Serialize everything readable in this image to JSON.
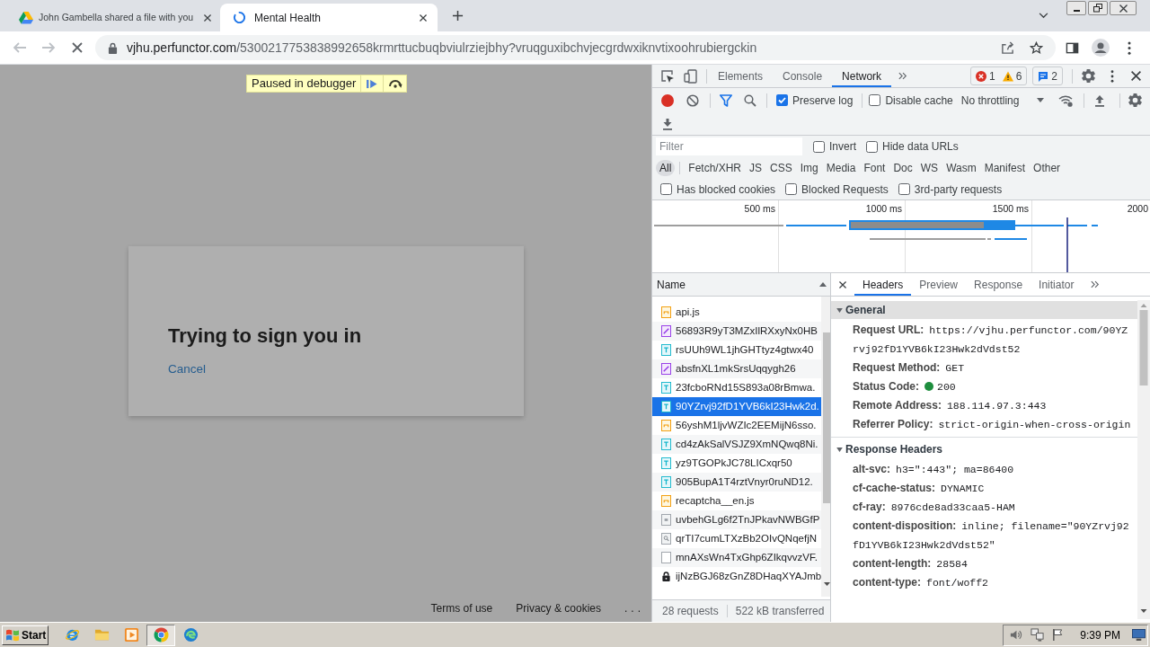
{
  "browser": {
    "tabs": [
      {
        "title": "John Gambella shared a file with you",
        "selected": false,
        "loading": false
      },
      {
        "title": "Mental Health",
        "selected": true,
        "loading": true
      }
    ],
    "address": {
      "domain": "vjhu.perfunctor.com",
      "path": "/5300217753838992658krmrttucbuqbviulrziejbhy?vruqguxibchvjecgrdwxiknvtixoohrubiergckin"
    }
  },
  "page": {
    "debugger_banner": "Paused in debugger",
    "dialog": {
      "heading": "Trying to sign you in",
      "cancel": "Cancel"
    },
    "footer_links": [
      "Terms of use",
      "Privacy & cookies",
      "..."
    ]
  },
  "devtools": {
    "tabs": [
      {
        "label": "Elements",
        "selected": false
      },
      {
        "label": "Console",
        "selected": false
      },
      {
        "label": "Network",
        "selected": true
      }
    ],
    "counters": [
      {
        "kind": "error",
        "count": "1"
      },
      {
        "kind": "warning",
        "count": "6"
      },
      {
        "kind": "message",
        "count": "2"
      }
    ],
    "toolbar": {
      "recording": true,
      "options": [
        {
          "label": "Preserve log",
          "checked": true
        },
        {
          "label": "Disable cache",
          "checked": false
        }
      ],
      "throttling": "No throttling"
    },
    "filter": {
      "placeholder": "Filter",
      "options": [
        {
          "label": "Invert",
          "checked": false
        },
        {
          "label": "Hide data URLs",
          "checked": false
        }
      ]
    },
    "types": [
      {
        "label": "All",
        "selected": true
      },
      {
        "label": "Fetch/XHR",
        "selected": false
      },
      {
        "label": "JS",
        "selected": false
      },
      {
        "label": "CSS",
        "selected": false
      },
      {
        "label": "Img",
        "selected": false
      },
      {
        "label": "Media",
        "selected": false
      },
      {
        "label": "Font",
        "selected": false
      },
      {
        "label": "Doc",
        "selected": false
      },
      {
        "label": "WS",
        "selected": false
      },
      {
        "label": "Wasm",
        "selected": false
      },
      {
        "label": "Manifest",
        "selected": false
      },
      {
        "label": "Other",
        "selected": false
      }
    ],
    "request_options": [
      {
        "label": "Has blocked cookies",
        "checked": false
      },
      {
        "label": "Blocked Requests",
        "checked": false
      },
      {
        "label": "3rd-party requests",
        "checked": false
      }
    ],
    "overview": {
      "ticks": [
        "500 ms",
        "1000 ms",
        "1500 ms",
        "2000"
      ]
    },
    "requests": {
      "column": "Name",
      "rows": [
        {
          "name": "api.js",
          "kind": "script",
          "selected": false
        },
        {
          "name": "56893R9yT3MZxIlRXxyNx0HB",
          "kind": "image",
          "selected": false
        },
        {
          "name": "rsUUh9WL1jhGHTtyz4gtwx40",
          "kind": "font",
          "selected": false
        },
        {
          "name": "absfnXL1mkSrsUqqygh26",
          "kind": "image",
          "selected": false
        },
        {
          "name": "23fcboRNd15S893a08rBmwa.",
          "kind": "font",
          "selected": false
        },
        {
          "name": "90YZrvj92fD1YVB6kI23Hwk2d.",
          "kind": "font",
          "selected": true
        },
        {
          "name": "56yshM1ljvWZIc2EEMijN6sso.",
          "kind": "script",
          "selected": false
        },
        {
          "name": "cd4zAkSalVSJZ9XmNQwq8Ni.",
          "kind": "font",
          "selected": false
        },
        {
          "name": "yz9TGOPkJC78LICxqr50",
          "kind": "font",
          "selected": false
        },
        {
          "name": "905BupA1T4rztVnyr0ruND12.",
          "kind": "font",
          "selected": false
        },
        {
          "name": "recaptcha__en.js",
          "kind": "script",
          "selected": false
        },
        {
          "name": "uvbehGLg6f2TnJPkavNWBGfP",
          "kind": "other",
          "selected": false
        },
        {
          "name": "qrTI7cumLTXzBb2OIvQNqefjN",
          "kind": "preview",
          "selected": false
        },
        {
          "name": "mnAXsWn4TxGhp6ZIkqvvzVF.",
          "kind": "document",
          "selected": false
        },
        {
          "name": "ijNzBGJ68zGnZ8DHaqXYAJmb",
          "kind": "locked",
          "selected": false
        }
      ],
      "summary": [
        "28 requests",
        "522 kB transferred"
      ]
    },
    "details": {
      "tabs": [
        {
          "label": "Headers",
          "selected": true
        },
        {
          "label": "Preview",
          "selected": false
        },
        {
          "label": "Response",
          "selected": false
        },
        {
          "label": "Initiator",
          "selected": false
        }
      ],
      "sections": [
        {
          "title": "General",
          "expanded": true,
          "selected": true,
          "rows": [
            {
              "kind": "field",
              "label": "Request URL:",
              "value": "https://vjhu.perfunctor.com/90YZrvj92fD1YVB6kI23Hwk2dVdst52"
            },
            {
              "kind": "field",
              "label": "Request Method:",
              "value": "GET"
            },
            {
              "kind": "status",
              "label": "Status Code:",
              "value": "200"
            },
            {
              "kind": "field",
              "label": "Remote Address:",
              "value": "188.114.97.3:443"
            },
            {
              "kind": "field",
              "label": "Referrer Policy:",
              "value": "strict-origin-when-cross-origin"
            }
          ]
        },
        {
          "title": "Response Headers",
          "expanded": true,
          "selected": false,
          "rows": [
            {
              "kind": "field",
              "label": "alt-svc:",
              "value": "h3=\":443\"; ma=86400"
            },
            {
              "kind": "field",
              "label": "cf-cache-status:",
              "value": "DYNAMIC"
            },
            {
              "kind": "field",
              "label": "cf-ray:",
              "value": "8976cde8ad33caa5-HAM"
            },
            {
              "kind": "field",
              "label": "content-disposition:",
              "value": "inline; filename=\"90YZrvj92fD1YVB6kI23Hwk2dVdst52\""
            },
            {
              "kind": "field",
              "label": "content-length:",
              "value": "28584"
            },
            {
              "kind": "field",
              "label": "content-type:",
              "value": "font/woff2"
            }
          ]
        }
      ]
    }
  },
  "taskbar": {
    "start": "Start",
    "apps": [
      {
        "kind": "e_logo",
        "active": false
      },
      {
        "kind": "folder",
        "active": false
      },
      {
        "kind": "player",
        "active": false
      },
      {
        "kind": "circle_logo",
        "active": true
      },
      {
        "kind": "swirl_logo",
        "active": false
      }
    ],
    "clock": "9:39 PM"
  }
}
